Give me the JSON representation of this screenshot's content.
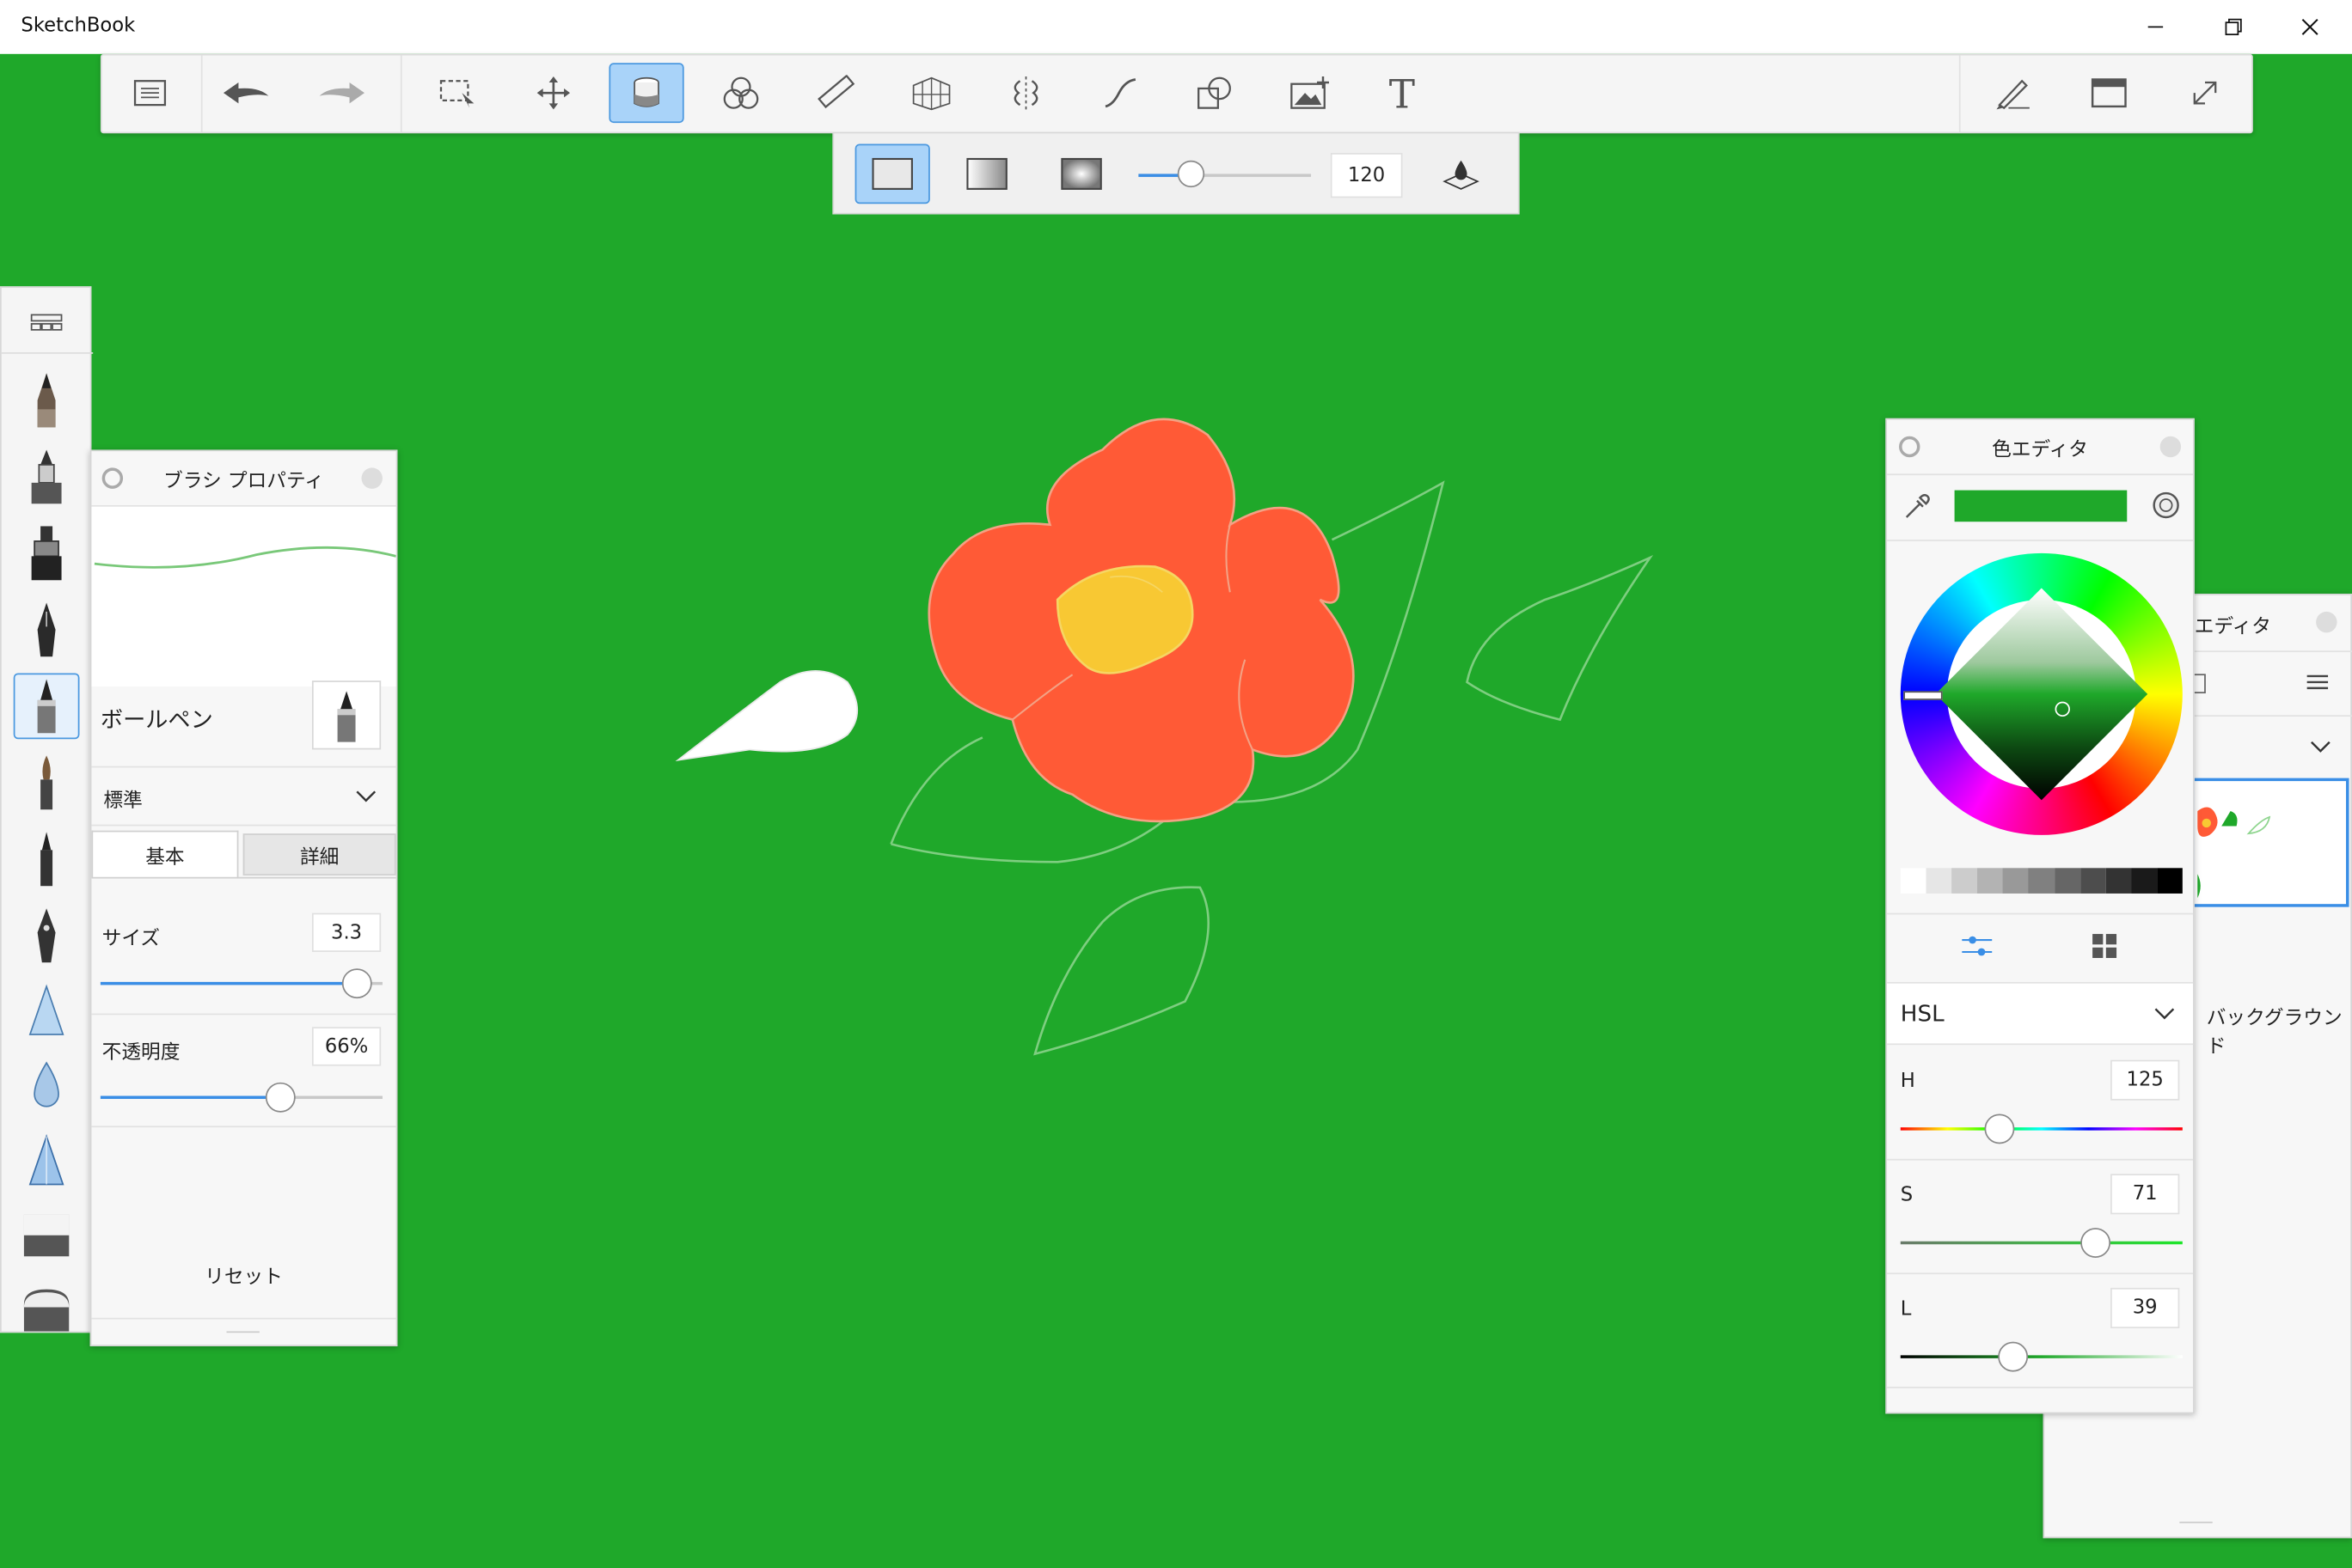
{
  "window": {
    "title": "SketchBook"
  },
  "subtoolbar": {
    "size_value": "120",
    "size_level": 0.3
  },
  "brush_panel": {
    "title": "ブラシ プロパティ",
    "brush_name": "ボールペン",
    "preset": "標準",
    "tabs": [
      "基本",
      "詳細"
    ],
    "size_label": "サイズ",
    "size_value": "3.3",
    "size_level": 0.91,
    "opacity_label": "不透明度",
    "opacity_value": "66%",
    "opacity_level": 0.64,
    "reset_label": "リセット"
  },
  "color_panel": {
    "title": "色エディタ",
    "current_color": "#1fa82a",
    "mode": "HSL",
    "h_label": "H",
    "h_value": "125",
    "h_level": 0.35,
    "s_label": "S",
    "s_value": "71",
    "s_level": 0.69,
    "l_label": "L",
    "l_value": "39",
    "l_level": 0.4
  },
  "layer_panel": {
    "title_partial": "エディタ",
    "background_label": "バックグラウンド"
  },
  "colors": {
    "canvas_green": "#1fa82a",
    "accent_blue": "#3a8ee6",
    "petal": "#ff5a36",
    "center": "#f8c833"
  }
}
